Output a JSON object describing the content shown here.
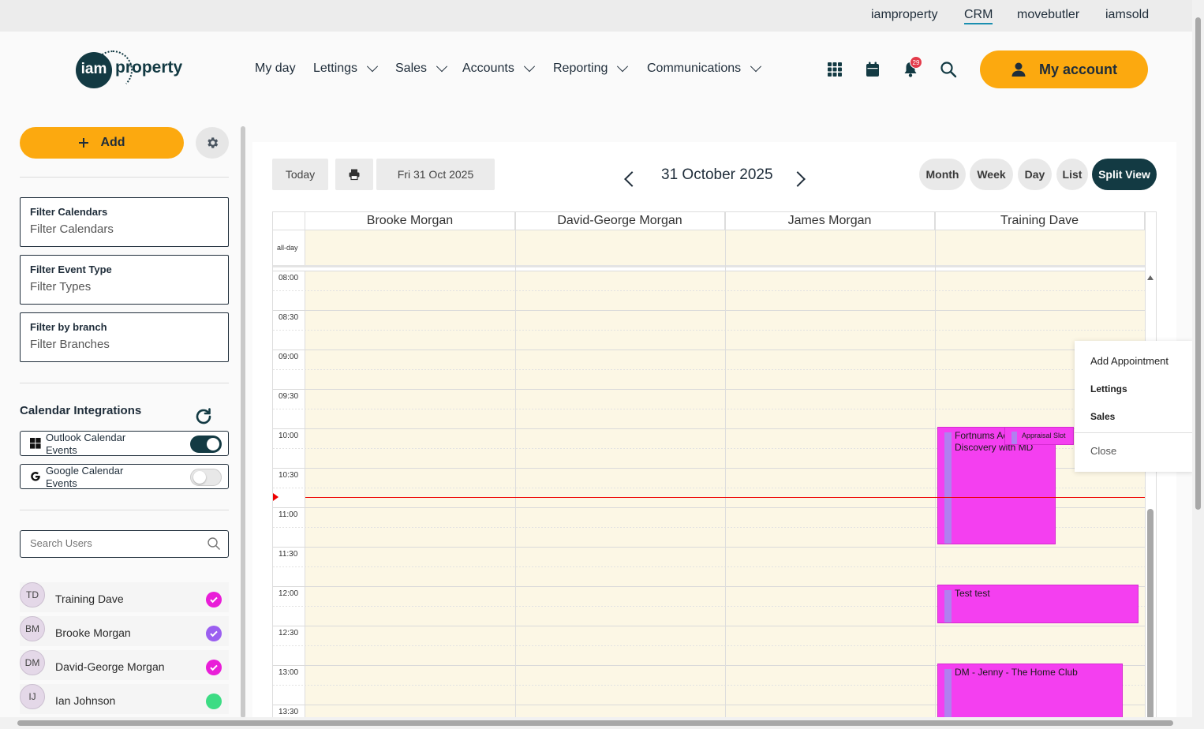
{
  "brand_links": [
    "iamproperty",
    "CRM",
    "movebutler",
    "iamsold"
  ],
  "brand_active": "CRM",
  "logo": {
    "mark": "iam",
    "text": "property"
  },
  "nav": [
    "My day",
    "Lettings",
    "Sales",
    "Accounts",
    "Reporting",
    "Communications"
  ],
  "header_icons": [
    "apps-grid-icon",
    "calendar-icon",
    "bell-icon",
    "search-icon"
  ],
  "notifications_count": "29",
  "account_label": "My account",
  "sidebar": {
    "add_label": "Add",
    "filters": [
      {
        "label": "Filter Calendars",
        "placeholder": "Filter Calendars"
      },
      {
        "label": "Filter Event Type",
        "placeholder": "Filter Types"
      },
      {
        "label": "Filter by branch",
        "placeholder": "Filter Branches"
      }
    ],
    "integrations_title": "Calendar Integrations",
    "integrations": [
      {
        "name": "Outlook Calendar Events",
        "icon": "windows-icon",
        "enabled": true
      },
      {
        "name": "Google Calendar Events",
        "icon": "google-icon",
        "enabled": false
      }
    ],
    "search_placeholder": "Search Users",
    "users": [
      {
        "initials": "TD",
        "name": "Training Dave",
        "color": "#e91ed8",
        "checked": true
      },
      {
        "initials": "BM",
        "name": "Brooke Morgan",
        "color": "#9b5ff0",
        "checked": true
      },
      {
        "initials": "DM",
        "name": "David-George Morgan",
        "color": "#e91ed8",
        "checked": true
      },
      {
        "initials": "IJ",
        "name": "Ian Johnson",
        "color": "#3ddc84",
        "checked": false
      }
    ]
  },
  "toolbar": {
    "today": "Today",
    "date_button": "Fri 31 Oct 2025",
    "title": "31 October 2025",
    "views": [
      "Month",
      "Week",
      "Day",
      "List",
      "Split View"
    ],
    "active_view": "Split View"
  },
  "calendar": {
    "columns": [
      "Brooke Morgan",
      "David-George Morgan",
      "James Morgan",
      "Training Dave"
    ],
    "allday_label": "all-day",
    "times": [
      "08:00",
      "08:30",
      "09:00",
      "09:30",
      "10:00",
      "10:30",
      "11:00",
      "11:30",
      "12:00",
      "12:30",
      "13:00",
      "13:30"
    ],
    "events": [
      {
        "title": "Fortnums Ac",
        "subtitle": "Discovery with MD"
      },
      {
        "title": "Appraisal Slot"
      },
      {
        "title": "Test test"
      },
      {
        "title": "DM - Jenny - The Home Club"
      }
    ],
    "event_color": "#f43ff0",
    "now_line_color": "#e00000"
  },
  "context_menu": {
    "items": [
      "Add Appointment",
      "Lettings",
      "Sales"
    ],
    "close": "Close"
  }
}
